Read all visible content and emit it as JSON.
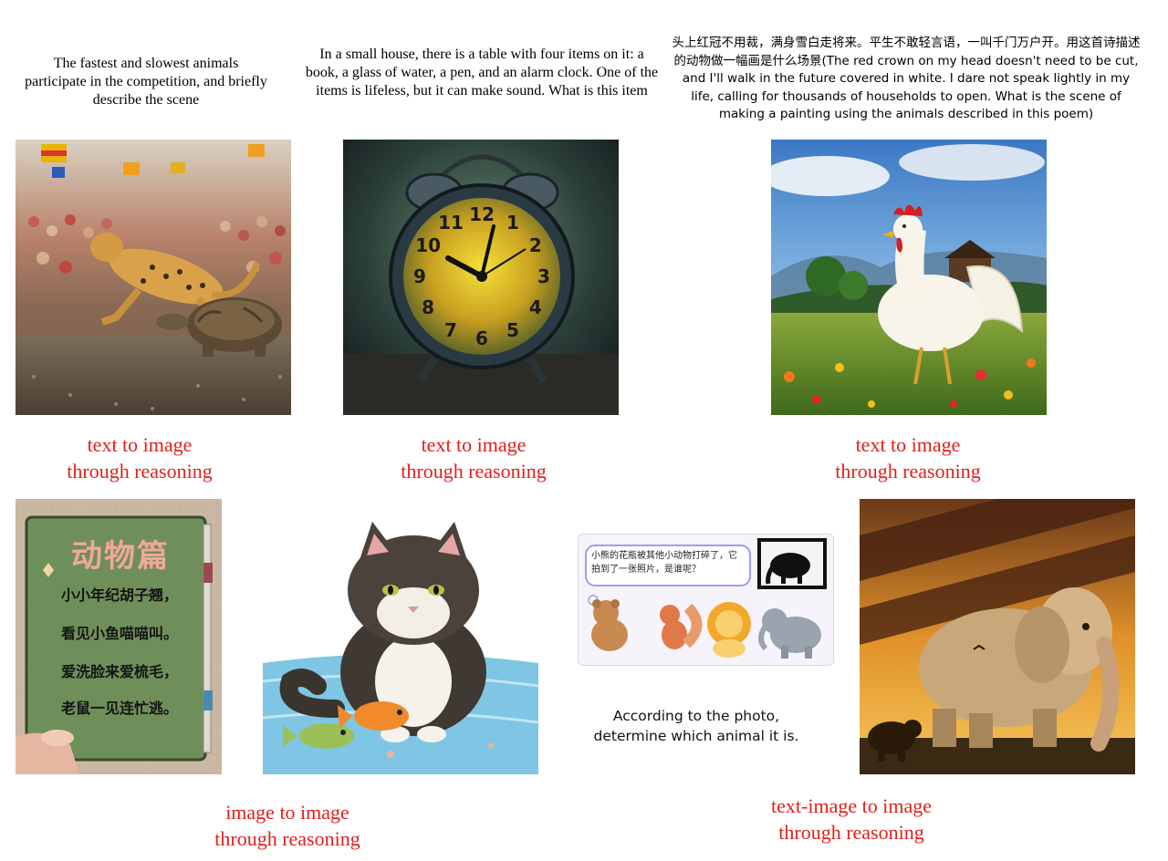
{
  "top_prompts": {
    "race": "The fastest and slowest animals participate in the competition, and briefly describe the scene",
    "item": "In a small house, there is a table with four items on it: a book, a glass of water, a pen, and an alarm clock. One of the items is lifeless, but it can make sound. What is this item",
    "poem_cn": "头上红冠不用裁，满身雪白走将来。平生不敢轻言语，一叫千门万户开。用这首诗描述的动物做一幅画是什么场景",
    "poem_en": "(The red crown on my head doesn't need to be cut, and I'll walk in the future covered in white. I dare not speak lightly in my life, calling for thousands of households to open. What is the scene of making a painting using the animals described in this poem)"
  },
  "labels": {
    "t2i_line1": "text to image",
    "t2i_line2": "through reasoning",
    "i2i_line1": "image to image",
    "i2i_line2": "through reasoning",
    "ti2i_line1": "text-image to image",
    "ti2i_line2": "through reasoning"
  },
  "book": {
    "title": "动物篇",
    "lines": [
      "小小年纪胡子翘，",
      "看见小鱼喵喵叫。",
      "爱洗脸来爱梳毛，",
      "老鼠一见连忙逃。"
    ]
  },
  "puzzle": {
    "bubble": "小熊的花瓶被其他小动物打碎了，它拍到了一张照片，是谁呢？",
    "caption": "According to the photo, determine which animal it is."
  },
  "clock_numbers": [
    "12",
    "1",
    "2",
    "3",
    "4",
    "5",
    "6",
    "7",
    "8",
    "9",
    "10",
    "11"
  ],
  "colors": {
    "label_red": "#e0201c"
  }
}
